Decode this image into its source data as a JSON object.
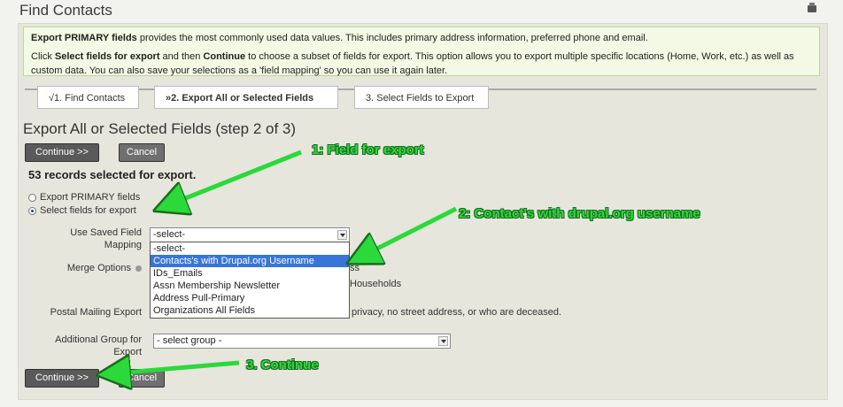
{
  "page": {
    "title": "Find Contacts"
  },
  "help": {
    "line1_bold": "Export PRIMARY fields",
    "line1_rest": " provides the most commonly used data values. This includes primary address information, preferred phone and email.",
    "line2_a": "Click ",
    "line2_bold1": "Select fields for export",
    "line2_b": " and then ",
    "line2_bold2": "Continue",
    "line2_c": " to choose a subset of fields for export. This option allows you to export multiple specific locations (Home, Work, etc.) as well as custom data. You can also save your selections as a 'field mapping' so you can use it again later."
  },
  "tabs": [
    {
      "label": "√1. Find Contacts"
    },
    {
      "label": "»2. Export All or Selected Fields"
    },
    {
      "label": "3. Select Fields to Export"
    }
  ],
  "step_title": "Export All or Selected Fields (step 2 of 3)",
  "buttons": {
    "continue": "Continue >>",
    "cancel": "Cancel"
  },
  "records_text": "53 records selected for export.",
  "export_options": {
    "primary": "Export PRIMARY fields",
    "select": "Select fields for export",
    "selected": "select"
  },
  "form": {
    "saved_mapping_label": "Use Saved Field Mapping",
    "saved_mapping_value": "-select-",
    "merge_label": "Merge Options",
    "merge_partial_1": "ss",
    "merge_partial_2": "Households",
    "postal_label": "Postal Mailing Export",
    "postal_partial": "privacy, no street address, or who are deceased.",
    "group_label": "Additional Group for Export",
    "group_value": "- select group -"
  },
  "dropdown_options": [
    "-select-",
    "Contacts's with Drupal.org Username",
    "IDs_Emails",
    "Assn Membership Newsletter",
    "Address Pull-Primary",
    "Organizations All Fields"
  ],
  "dropdown_selected_index": 1,
  "annotations": {
    "a1": "1: Field for export",
    "a2": "2: Contact's with drupal.org username",
    "a3": "3. Continue"
  },
  "colors": {
    "annotation": "#2bd93a",
    "highlight": "#3875d7"
  }
}
